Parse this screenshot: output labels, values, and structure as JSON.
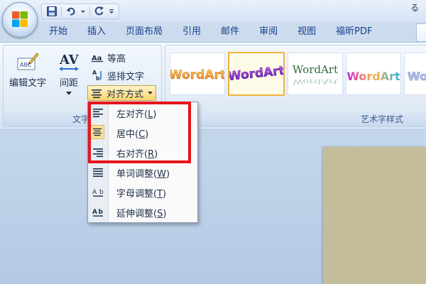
{
  "title_bar": {
    "edge_text": "る"
  },
  "quick_access": {
    "icons": [
      "save-icon",
      "undo-icon",
      "dropdown-icon",
      "redo-icon",
      "customize-icon"
    ]
  },
  "tabs": [
    "开始",
    "插入",
    "页面布局",
    "引用",
    "邮件",
    "审阅",
    "视图",
    "福昕PDF"
  ],
  "ribbon": {
    "text_group": {
      "label": "文字",
      "edit_text": "编辑文字",
      "spacing": "间距",
      "equal_height": "等高",
      "vertical_text": "竖排文字",
      "alignment": "对齐方式"
    },
    "wordart_group": {
      "label": "艺术字样式",
      "items": [
        {
          "text": "WordArt",
          "selected": false
        },
        {
          "text": "WordArt",
          "selected": true
        },
        {
          "text": "WordArt",
          "selected": false
        },
        {
          "text": "WordArt",
          "selected": false
        },
        {
          "text": "WordArt",
          "selected": false
        }
      ]
    }
  },
  "alignment_menu": {
    "items": [
      {
        "label": "左对齐",
        "hotkey": "L",
        "checked": false
      },
      {
        "label": "居中",
        "hotkey": "C",
        "checked": true
      },
      {
        "label": "右对齐",
        "hotkey": "R",
        "checked": false
      },
      {
        "label": "单词调整",
        "hotkey": "W",
        "checked": false
      },
      {
        "label": "字母调整",
        "hotkey": "T",
        "checked": false
      },
      {
        "label": "延伸调整",
        "hotkey": "S",
        "checked": false
      }
    ]
  },
  "annotation": {
    "color": "#e8141b"
  }
}
